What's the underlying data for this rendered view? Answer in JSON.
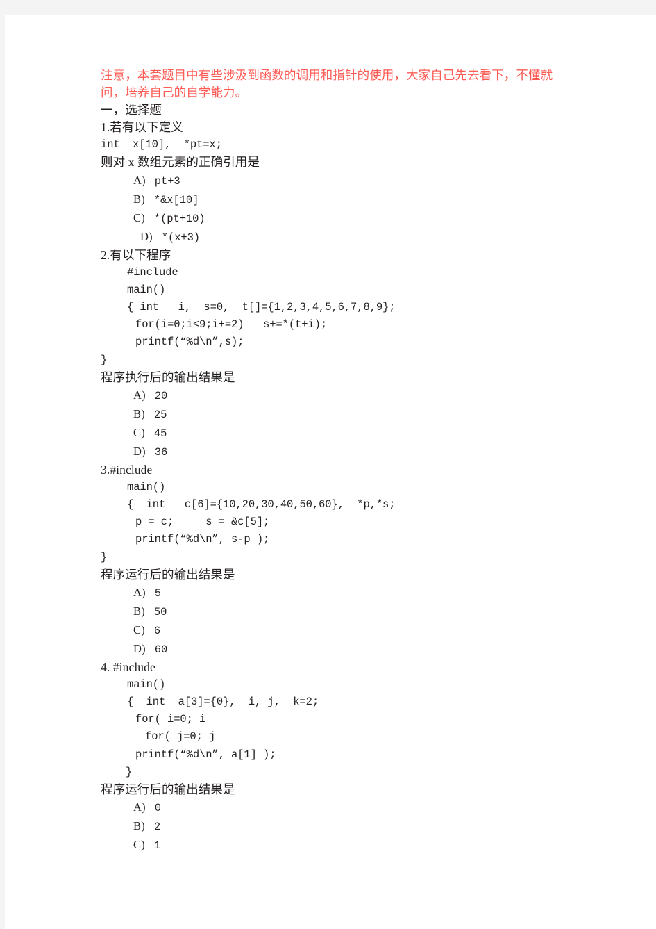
{
  "document": {
    "notice": {
      "text": "注意，本套题目中有些涉汲到函数的调用和指针的使用，大家自己先去看下，不懂就问，培养自己的自学能力。",
      "color": "#ff5b55"
    },
    "section_title": "一，选择题",
    "questions": [
      {
        "number": "1.",
        "stem": "1.若有以下定义",
        "code_lines": [
          {
            "text": "int  x[10],  *pt=x;",
            "indent": "indent-0"
          }
        ],
        "prompt": "则对 x 数组元素的正确引用是",
        "options": [
          {
            "label": "A)",
            "value": "pt+3",
            "indent": "indent-opt"
          },
          {
            "label": "B)",
            "value": "*&x[10]",
            "indent": "indent-opt"
          },
          {
            "label": "C)",
            "value": "*(pt+10)",
            "indent": "indent-opt"
          },
          {
            "label": "D)",
            "value": "*(x+3)",
            "indent": "indent-opt-d"
          }
        ]
      },
      {
        "number": "2.",
        "stem": "2.有以下程序",
        "code_lines": [
          {
            "text": "#include",
            "indent": "indent-1"
          },
          {
            "text": "main()",
            "indent": "indent-1"
          },
          {
            "text": "{ int   i,  s=0,  t[]={1,2,3,4,5,6,7,8,9};",
            "indent": "indent-1"
          },
          {
            "text": "for(i=0;i<9;i+=2)   s+=*(t+i);",
            "indent": "indent-2"
          },
          {
            "text": "printf(“%d\\n”,s);",
            "indent": "indent-2"
          },
          {
            "text": "}",
            "indent": "indent-0"
          }
        ],
        "prompt": "程序执行后的输出结果是",
        "options": [
          {
            "label": "A)",
            "value": "20",
            "indent": "indent-opt"
          },
          {
            "label": "B)",
            "value": "25",
            "indent": "indent-opt"
          },
          {
            "label": "C)",
            "value": "45",
            "indent": "indent-opt"
          },
          {
            "label": "D)",
            "value": "36",
            "indent": "indent-opt"
          }
        ]
      },
      {
        "number": "3.",
        "stem": "3.#include",
        "code_lines": [
          {
            "text": "main()",
            "indent": "indent-1"
          },
          {
            "text": "{  int   c[6]={10,20,30,40,50,60},  *p,*s;",
            "indent": "indent-1"
          },
          {
            "text": "p = c;     s = &c[5];",
            "indent": "indent-2"
          },
          {
            "text": "printf(“%d\\n”, s-p );",
            "indent": "indent-2"
          },
          {
            "text": "}",
            "indent": "indent-0"
          }
        ],
        "prompt": "程序运行后的输出结果是",
        "options": [
          {
            "label": "A)",
            "value": "5",
            "indent": "indent-opt"
          },
          {
            "label": "B)",
            "value": "50",
            "indent": "indent-opt"
          },
          {
            "label": "C)",
            "value": "6",
            "indent": "indent-opt"
          },
          {
            "label": "D)",
            "value": "60",
            "indent": "indent-opt"
          }
        ]
      },
      {
        "number": "4.",
        "stem": "4. #include",
        "code_lines": [
          {
            "text": "main()",
            "indent": "indent-1"
          },
          {
            "text": "{  int  a[3]={0},  i, j,  k=2;",
            "indent": "indent-1"
          },
          {
            "text": "for( i=0; i",
            "indent": "indent-2"
          },
          {
            "text": "for( j=0; j",
            "indent": "indent-3"
          },
          {
            "text": "printf(“%d\\n”, a[1] );",
            "indent": "indent-2"
          },
          {
            "text": "}",
            "indent": "indent-brace"
          }
        ],
        "prompt": "程序运行后的输出结果是",
        "options": [
          {
            "label": "A)",
            "value": "0",
            "indent": "indent-opt"
          },
          {
            "label": "B)",
            "value": "2",
            "indent": "indent-opt"
          },
          {
            "label": "C)",
            "value": "1",
            "indent": "indent-opt"
          }
        ]
      }
    ]
  }
}
